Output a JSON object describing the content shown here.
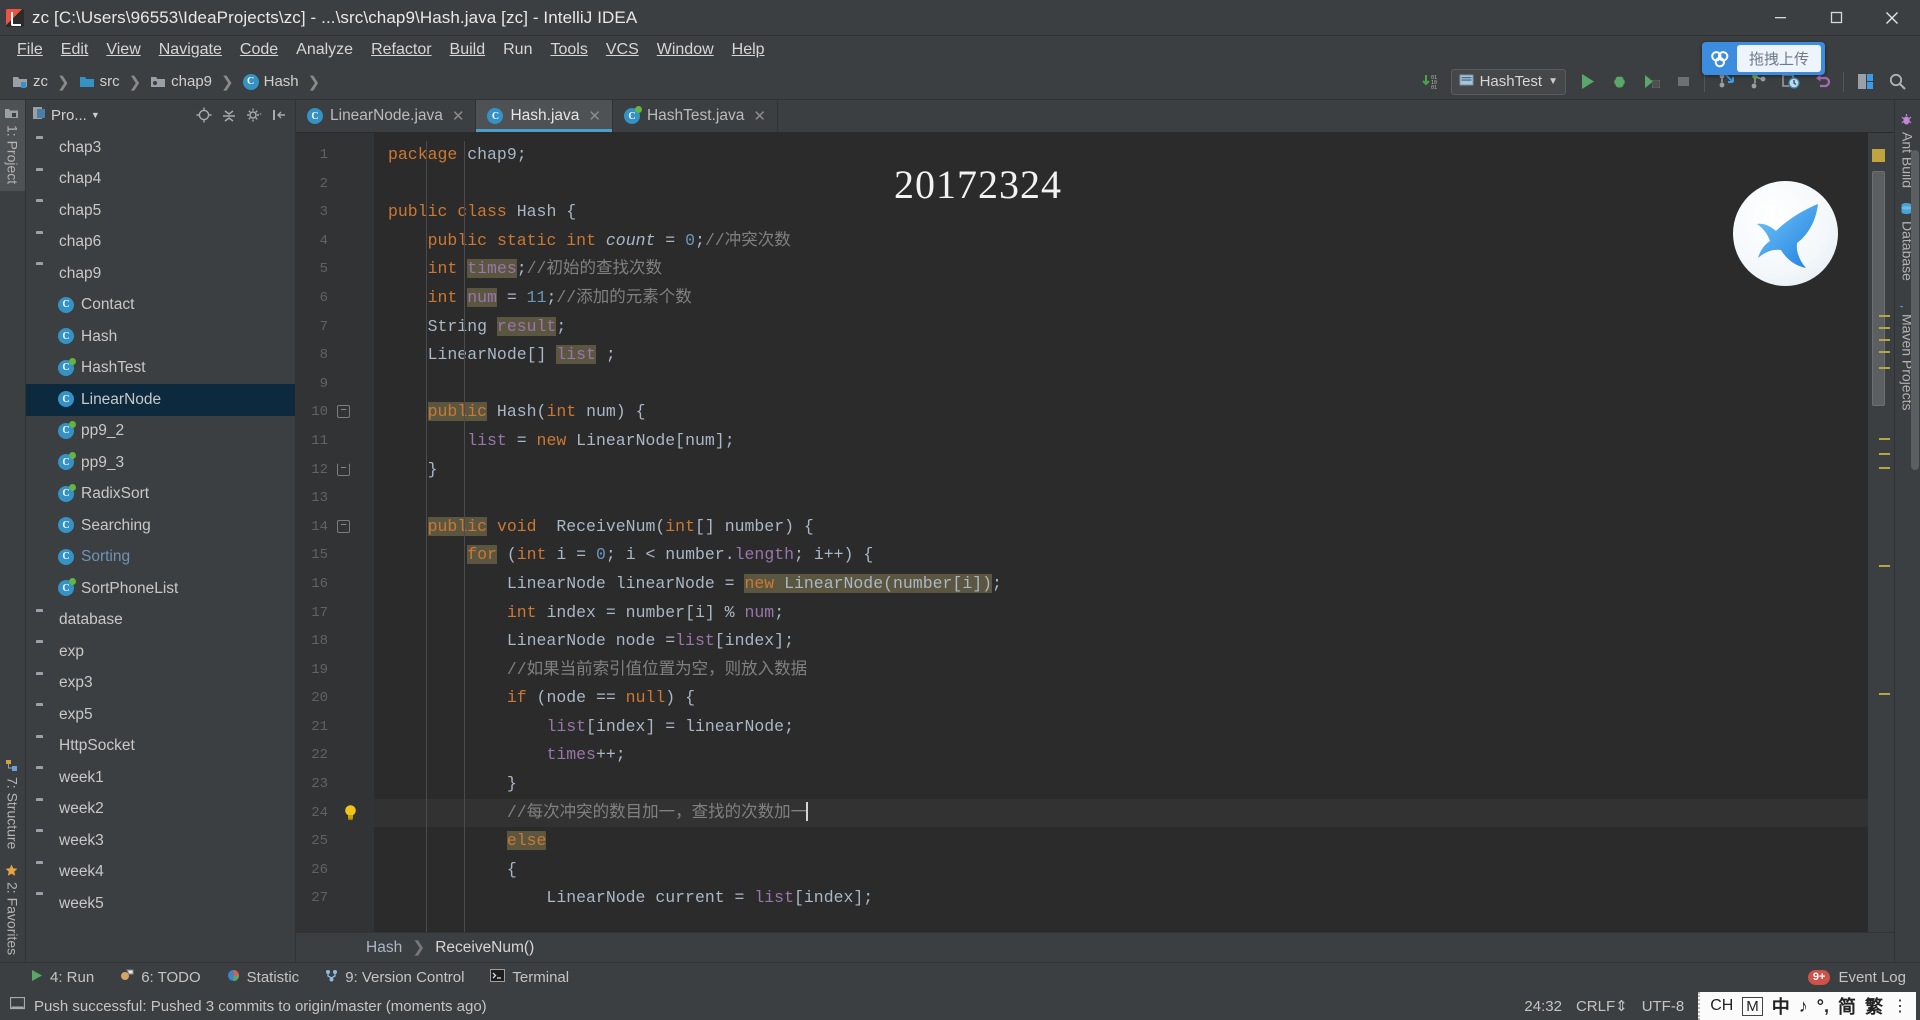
{
  "window": {
    "title": "zc [C:\\Users\\96553\\IdeaProjects\\zc] - ...\\src\\chap9\\Hash.java [zc] - IntelliJ IDEA",
    "app_icon": "intellij-idea-icon",
    "minimize_label": "Minimize",
    "maximize_label": "Maximize",
    "close_label": "Close"
  },
  "menubar": {
    "items": [
      {
        "label": "File",
        "mnemonic": "F"
      },
      {
        "label": "Edit",
        "mnemonic": "E"
      },
      {
        "label": "View",
        "mnemonic": "V"
      },
      {
        "label": "Navigate",
        "mnemonic": "N"
      },
      {
        "label": "Code",
        "mnemonic": "C"
      },
      {
        "label": "Analyze",
        "mnemonic": "y"
      },
      {
        "label": "Refactor",
        "mnemonic": "R"
      },
      {
        "label": "Build",
        "mnemonic": "B"
      },
      {
        "label": "Run",
        "mnemonic": "u"
      },
      {
        "label": "Tools",
        "mnemonic": "T"
      },
      {
        "label": "VCS",
        "mnemonic": "S"
      },
      {
        "label": "Window",
        "mnemonic": "W"
      },
      {
        "label": "Help",
        "mnemonic": "H"
      }
    ]
  },
  "upload_overlay": {
    "label": "拖拽上传",
    "icon": "cloud-upload-icon",
    "color": "#3c8ce0"
  },
  "navbar": {
    "breadcrumb": [
      {
        "label": "zc",
        "icon": "module-folder-icon"
      },
      {
        "label": "src",
        "icon": "source-folder-icon"
      },
      {
        "label": "chap9",
        "icon": "package-folder-icon"
      },
      {
        "label": "Hash",
        "icon": "java-class-icon"
      }
    ],
    "run_config": "HashTest",
    "run_config_icon": "run-configuration-icon",
    "actions": [
      {
        "name": "update-project-icon",
        "label": "Update Project"
      },
      {
        "name": "run-icon",
        "label": "Run"
      },
      {
        "name": "debug-icon",
        "label": "Debug"
      },
      {
        "name": "run-with-coverage-icon",
        "label": "Run with Coverage"
      },
      {
        "name": "stop-icon",
        "label": "Stop"
      },
      {
        "name": "update-vcs-icon",
        "label": "Update"
      },
      {
        "name": "commit-icon",
        "label": "Commit"
      },
      {
        "name": "history-icon",
        "label": "Show History"
      },
      {
        "name": "rollback-icon",
        "label": "Rollback"
      },
      {
        "name": "settings-icon",
        "label": "Settings"
      },
      {
        "name": "search-icon",
        "label": "Search Everywhere"
      }
    ]
  },
  "left_rail": {
    "items": [
      {
        "label": "1: Project",
        "icon": "project-icon",
        "active": true
      },
      {
        "label": "7: Structure",
        "icon": "structure-icon",
        "active": false
      },
      {
        "label": "2: Favorites",
        "icon": "favorites-icon",
        "active": false
      }
    ]
  },
  "right_rail": {
    "items": [
      {
        "label": "Ant Build",
        "icon": "ant-icon"
      },
      {
        "label": "Database",
        "icon": "database-icon"
      },
      {
        "label": "Maven Projects",
        "icon": "maven-icon"
      }
    ]
  },
  "project_panel": {
    "title": "Pro...",
    "title_icon": "project-view-icon",
    "tools": [
      {
        "name": "locate-icon",
        "label": "Select Opened File"
      },
      {
        "name": "collapse-all-icon",
        "label": "Collapse All"
      },
      {
        "name": "settings-gear-icon",
        "label": "Show Options Menu"
      },
      {
        "name": "hide-panel-icon",
        "label": "Hide"
      }
    ],
    "tree": [
      {
        "label": "chap3",
        "type": "folder",
        "indent": 0,
        "selected": false,
        "runnable": false
      },
      {
        "label": "chap4",
        "type": "folder",
        "indent": 0,
        "selected": false,
        "runnable": false
      },
      {
        "label": "chap5",
        "type": "folder",
        "indent": 0,
        "selected": false,
        "runnable": false
      },
      {
        "label": "chap6",
        "type": "folder",
        "indent": 0,
        "selected": false,
        "runnable": false
      },
      {
        "label": "chap9",
        "type": "folder",
        "indent": 0,
        "selected": false,
        "runnable": false
      },
      {
        "label": "Contact",
        "type": "class",
        "indent": 1,
        "selected": false,
        "runnable": false
      },
      {
        "label": "Hash",
        "type": "class",
        "indent": 1,
        "selected": false,
        "runnable": false
      },
      {
        "label": "HashTest",
        "type": "class",
        "indent": 1,
        "selected": false,
        "runnable": true
      },
      {
        "label": "LinearNode",
        "type": "class",
        "indent": 1,
        "selected": true,
        "runnable": false
      },
      {
        "label": "pp9_2",
        "type": "class",
        "indent": 1,
        "selected": false,
        "runnable": true
      },
      {
        "label": "pp9_3",
        "type": "class",
        "indent": 1,
        "selected": false,
        "runnable": true
      },
      {
        "label": "RadixSort",
        "type": "class",
        "indent": 1,
        "selected": false,
        "runnable": true
      },
      {
        "label": "Searching",
        "type": "class",
        "indent": 1,
        "selected": false,
        "runnable": false
      },
      {
        "label": "Sorting",
        "type": "class",
        "indent": 1,
        "selected": false,
        "runnable": false,
        "muted": true
      },
      {
        "label": "SortPhoneList",
        "type": "class",
        "indent": 1,
        "selected": false,
        "runnable": true
      },
      {
        "label": "database",
        "type": "folder",
        "indent": 0,
        "selected": false,
        "runnable": false
      },
      {
        "label": "exp",
        "type": "folder",
        "indent": 0,
        "selected": false,
        "runnable": false
      },
      {
        "label": "exp3",
        "type": "folder",
        "indent": 0,
        "selected": false,
        "runnable": false
      },
      {
        "label": "exp5",
        "type": "folder",
        "indent": 0,
        "selected": false,
        "runnable": false
      },
      {
        "label": "HttpSocket",
        "type": "folder",
        "indent": 0,
        "selected": false,
        "runnable": false
      },
      {
        "label": "week1",
        "type": "folder",
        "indent": 0,
        "selected": false,
        "runnable": false
      },
      {
        "label": "week2",
        "type": "folder",
        "indent": 0,
        "selected": false,
        "runnable": false
      },
      {
        "label": "week3",
        "type": "folder",
        "indent": 0,
        "selected": false,
        "runnable": false
      },
      {
        "label": "week4",
        "type": "folder",
        "indent": 0,
        "selected": false,
        "runnable": false
      },
      {
        "label": "week5",
        "type": "folder",
        "indent": 0,
        "selected": false,
        "runnable": false
      }
    ]
  },
  "editor": {
    "tabs": [
      {
        "label": "LinearNode.java",
        "icon": "java-class-icon",
        "active": false,
        "runnable": false
      },
      {
        "label": "Hash.java",
        "icon": "java-class-icon",
        "active": true,
        "runnable": false
      },
      {
        "label": "HashTest.java",
        "icon": "java-class-icon",
        "active": false,
        "runnable": true
      }
    ],
    "watermark": "20172324",
    "logo_icon": "blue-bird-logo",
    "first_line": 1,
    "lines": [
      {
        "n": 1,
        "fold": "",
        "bulb": false,
        "current": false
      },
      {
        "n": 2,
        "fold": "",
        "bulb": false,
        "current": false
      },
      {
        "n": 3,
        "fold": "",
        "bulb": false,
        "current": false
      },
      {
        "n": 4,
        "fold": "",
        "bulb": false,
        "current": false
      },
      {
        "n": 5,
        "fold": "",
        "bulb": false,
        "current": false
      },
      {
        "n": 6,
        "fold": "",
        "bulb": false,
        "current": false
      },
      {
        "n": 7,
        "fold": "",
        "bulb": false,
        "current": false
      },
      {
        "n": 8,
        "fold": "",
        "bulb": false,
        "current": false
      },
      {
        "n": 9,
        "fold": "",
        "bulb": false,
        "current": false
      },
      {
        "n": 10,
        "fold": "minus",
        "bulb": false,
        "current": false
      },
      {
        "n": 11,
        "fold": "",
        "bulb": false,
        "current": false
      },
      {
        "n": 12,
        "fold": "end",
        "bulb": false,
        "current": false
      },
      {
        "n": 13,
        "fold": "",
        "bulb": false,
        "current": false
      },
      {
        "n": 14,
        "fold": "minus",
        "bulb": false,
        "current": false
      },
      {
        "n": 15,
        "fold": "",
        "bulb": false,
        "current": false
      },
      {
        "n": 16,
        "fold": "",
        "bulb": false,
        "current": false
      },
      {
        "n": 17,
        "fold": "",
        "bulb": false,
        "current": false
      },
      {
        "n": 18,
        "fold": "",
        "bulb": false,
        "current": false
      },
      {
        "n": 19,
        "fold": "",
        "bulb": false,
        "current": false
      },
      {
        "n": 20,
        "fold": "",
        "bulb": false,
        "current": false
      },
      {
        "n": 21,
        "fold": "",
        "bulb": false,
        "current": false
      },
      {
        "n": 22,
        "fold": "",
        "bulb": false,
        "current": false
      },
      {
        "n": 23,
        "fold": "",
        "bulb": false,
        "current": false
      },
      {
        "n": 24,
        "fold": "",
        "bulb": true,
        "current": true
      },
      {
        "n": 25,
        "fold": "",
        "bulb": false,
        "current": false
      },
      {
        "n": 26,
        "fold": "",
        "bulb": false,
        "current": false
      },
      {
        "n": 27,
        "fold": "",
        "bulb": false,
        "current": false
      }
    ],
    "source_text": [
      "package chap9;",
      "",
      "public class Hash {",
      "    public static int count = 0;//冲突次数",
      "    int times;//初始的查找次数",
      "    int num = 11;//添加的元素个数",
      "    String result;",
      "    LinearNode[] list ;",
      "",
      "    public Hash(int num) {",
      "        list = new LinearNode[num];",
      "    }",
      "",
      "    public void  ReceiveNum(int[] number) {",
      "        for (int i = 0; i < number.length; i++) {",
      "            LinearNode linearNode = new LinearNode(number[i]);",
      "            int index = number[i] % num;",
      "            LinearNode node =list[index];",
      "            //如果当前索引值位置为空，则放入数据",
      "            if (node == null) {",
      "                list[index] = linearNode;",
      "                times++;",
      "            }",
      "            //每次冲突的数目加一，查找的次数加一",
      "            else",
      "            {",
      "                LinearNode current = list[index];"
    ],
    "breadcrumb": {
      "class": "Hash",
      "method": "ReceiveNum()"
    }
  },
  "toolwindows": {
    "items": [
      {
        "label": "4: Run",
        "mnemonic": "4",
        "icon": "run-icon"
      },
      {
        "label": "6: TODO",
        "mnemonic": "6",
        "icon": "todo-icon"
      },
      {
        "label": "Statistic",
        "mnemonic": "",
        "icon": "statistic-icon"
      },
      {
        "label": "9: Version Control",
        "mnemonic": "9",
        "icon": "version-control-icon"
      },
      {
        "label": "Terminal",
        "mnemonic": "",
        "icon": "terminal-icon"
      }
    ],
    "event_log": {
      "label": "Event Log",
      "badge": "9+",
      "icon": "event-log-icon"
    }
  },
  "statusbar": {
    "message": "Push successful: Pushed 3 commits to origin/master (moments ago)",
    "message_icon": "notification-icon",
    "caret_position": "24:32",
    "line_separator": "CRLF",
    "encoding": "UTF-8",
    "ime": {
      "items": [
        "CH",
        "M",
        "中",
        "♪",
        "°,",
        "简",
        "繁"
      ],
      "more": "⋮"
    }
  },
  "colors": {
    "accent": "#4a9ec9",
    "selection": "#0d293e",
    "keyword": "#cc7832",
    "number": "#6897bb",
    "field": "#9876aa",
    "comment": "#808080",
    "text": "#a9b7c6",
    "highlight": "#5b5640",
    "brand_blue": "#3c8ce0",
    "green_run": "#62b543"
  }
}
